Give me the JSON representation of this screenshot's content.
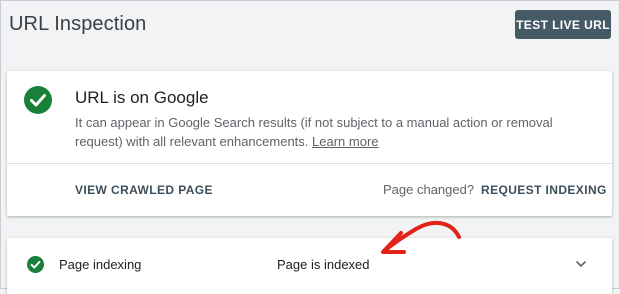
{
  "header": {
    "title": "URL Inspection",
    "test_live_label": "TEST LIVE URL"
  },
  "status": {
    "title": "URL is on Google",
    "description": "It can appear in Google Search results (if not subject to a manual action or removal request) with all relevant enhancements.",
    "learn_more": "Learn more",
    "icon": "check-circle-icon",
    "color": "#188038"
  },
  "actions": {
    "view_crawled": "VIEW CRAWLED PAGE",
    "page_changed": "Page changed?",
    "request_indexing": "REQUEST INDEXING"
  },
  "coverage": {
    "label": "Page indexing",
    "value": "Page is indexed",
    "icon": "check-circle-icon",
    "expand_icon": "chevron-down-icon"
  },
  "annotation": {
    "icon": "red-arrow-icon",
    "color": "#e2231a"
  },
  "colors": {
    "button_bg": "#455a64",
    "action_text": "#3c4f5c",
    "page_bg": "#f1f3f4"
  }
}
